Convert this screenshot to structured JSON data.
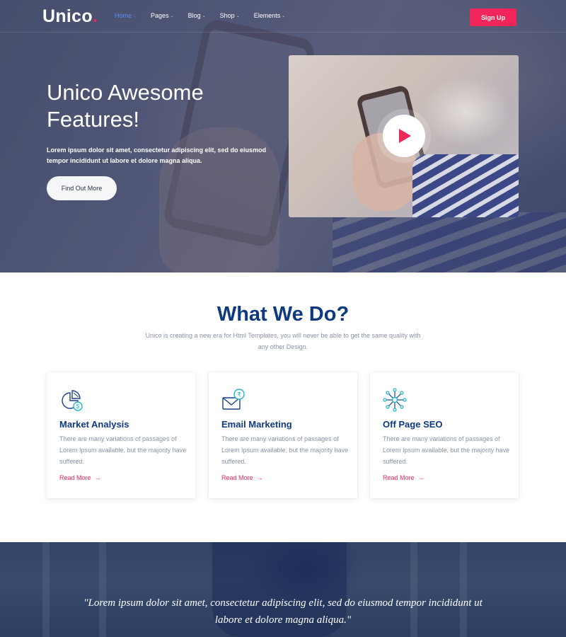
{
  "brand": {
    "name": "Unico",
    "dot": ".",
    "accent": "#f0265a",
    "primary": "#0f3a7d"
  },
  "nav": {
    "items": [
      {
        "label": "Home",
        "active": true
      },
      {
        "label": "Pages"
      },
      {
        "label": "Blog"
      },
      {
        "label": "Shop"
      },
      {
        "label": "Elements"
      }
    ],
    "signup_label": "Sign Up"
  },
  "hero": {
    "title": "Unico Awesome Features!",
    "text": "Lorem ipsum dolor sit amet, consectetur adipiscing elit, sed do eiusmod tempor incididunt ut labore et dolore magna aliqua.",
    "button_label": "Find Out More",
    "video_icon": "play-icon"
  },
  "services": {
    "title": "What We Do?",
    "subtitle": "Unico is creating a new era for Html Templates, you will never be able to get the same quality with any other Design.",
    "cards": [
      {
        "icon": "pie-chart-dollar-icon",
        "title": "Market Analysis",
        "text": "There are many variations of passages of Lorem Ipsum available, but the majority have suffered.",
        "link": "Read More"
      },
      {
        "icon": "email-rupee-icon",
        "title": "Email Marketing",
        "text": "There are many variations of passages of Lorem Ipsum available, but the majority have suffered.",
        "link": "Read More"
      },
      {
        "icon": "network-nodes-icon",
        "title": "Off Page SEO",
        "text": "There are many variations of passages of Lorem Ipsum available, but the majority have suffered.",
        "link": "Read More"
      }
    ]
  },
  "testimonial": {
    "quote": "\"Lorem ipsum dolor sit amet, consectetur adipiscing elit, sed do eiusmod tempor incididunt ut labore et dolore magna aliqua.\""
  }
}
